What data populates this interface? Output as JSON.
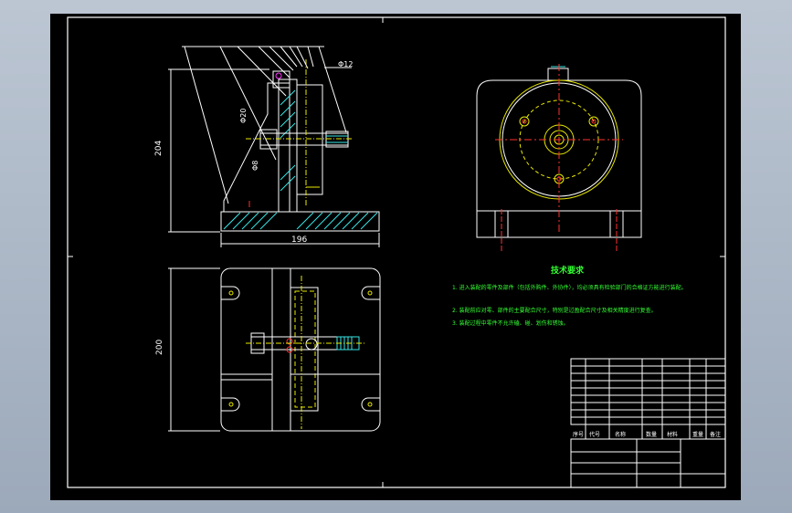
{
  "dimensions": {
    "height_main": "204",
    "width_main": "196",
    "height_top": "200",
    "dia_a": "Φ12",
    "dia_b": "Φ20",
    "dia_c": "Φ8"
  },
  "tech_requirements": {
    "title": "技术要求",
    "lines": [
      "1. 进入装配的零件及部件（包括外购件、外协件），均必须具有检验部门的合格证方能进行装配。",
      "2. 装配前应对零、部件的主要配合尺寸，特别是过盈配合尺寸及相关精度进行复查。",
      "3. 装配过程中零件不允许磕、碰、划伤和锈蚀。"
    ]
  },
  "title_block": {
    "col_no": "序号",
    "col_code": "代号",
    "col_name": "名称",
    "col_qty": "数量",
    "col_material": "材料",
    "col_weight": "重量",
    "col_remark": "备注"
  }
}
